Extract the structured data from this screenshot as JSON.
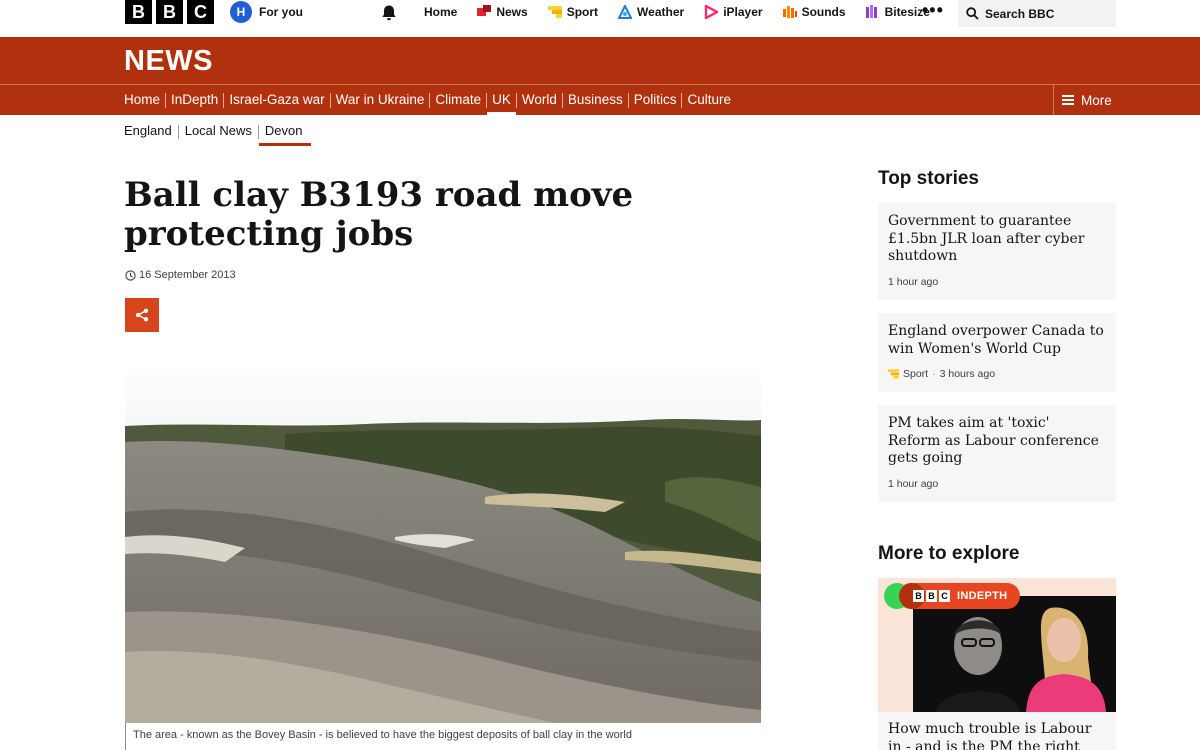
{
  "topbar": {
    "logo_letters": [
      "B",
      "B",
      "C"
    ],
    "avatar_letter": "H",
    "for_you": "For you",
    "nav": [
      {
        "label": "Home",
        "icon": "none"
      },
      {
        "label": "News",
        "icon": "news-icon",
        "color": "#e3242b"
      },
      {
        "label": "Sport",
        "icon": "sport-icon",
        "color": "#ffd230"
      },
      {
        "label": "Weather",
        "icon": "weather-icon",
        "color": "#1f7ae0"
      },
      {
        "label": "iPlayer",
        "icon": "iplayer-icon",
        "color": "#ff2c6d"
      },
      {
        "label": "Sounds",
        "icon": "sounds-icon",
        "color": "#ff6b00"
      },
      {
        "label": "Bitesize",
        "icon": "bitesize-icon",
        "color": "#8a3fd1"
      }
    ],
    "more_dots": "•••",
    "search_label": "Search BBC"
  },
  "news": {
    "title": "NEWS",
    "nav": [
      {
        "label": "Home",
        "active": false
      },
      {
        "label": "InDepth",
        "active": false
      },
      {
        "label": "Israel-Gaza war",
        "active": false
      },
      {
        "label": "War in Ukraine",
        "active": false
      },
      {
        "label": "Climate",
        "active": false
      },
      {
        "label": "UK",
        "active": true
      },
      {
        "label": "World",
        "active": false
      },
      {
        "label": "Business",
        "active": false
      },
      {
        "label": "Politics",
        "active": false
      },
      {
        "label": "Culture",
        "active": false
      }
    ],
    "more_label": "More",
    "brand_color": "#b1300e"
  },
  "subnav": [
    {
      "label": "England",
      "active": false
    },
    {
      "label": "Local News",
      "active": false
    },
    {
      "label": "Devon",
      "active": true
    }
  ],
  "article": {
    "headline": "Ball clay B3193 road move protecting jobs",
    "date": "16 September 2013",
    "caption": "The area - known as the Bovey Basin - is believed to have the biggest deposits of ball clay in the world"
  },
  "top_stories": {
    "title": "Top stories",
    "items": [
      {
        "headline": "Government to guarantee £1.5bn JLR loan after cyber shutdown",
        "source": "",
        "time": "1 hour ago"
      },
      {
        "headline": "England overpower Canada to win Women's World Cup",
        "source": "Sport",
        "time": "3 hours ago"
      },
      {
        "headline": "PM takes aim at 'toxic' Reform as Labour conference gets going",
        "source": "",
        "time": "1 hour ago"
      }
    ]
  },
  "more_to_explore": {
    "title": "More to explore",
    "badge_letters": [
      "B",
      "B",
      "C"
    ],
    "badge_label": "INDEPTH",
    "headline": "How much trouble is Labour in - and is the PM the right man"
  }
}
